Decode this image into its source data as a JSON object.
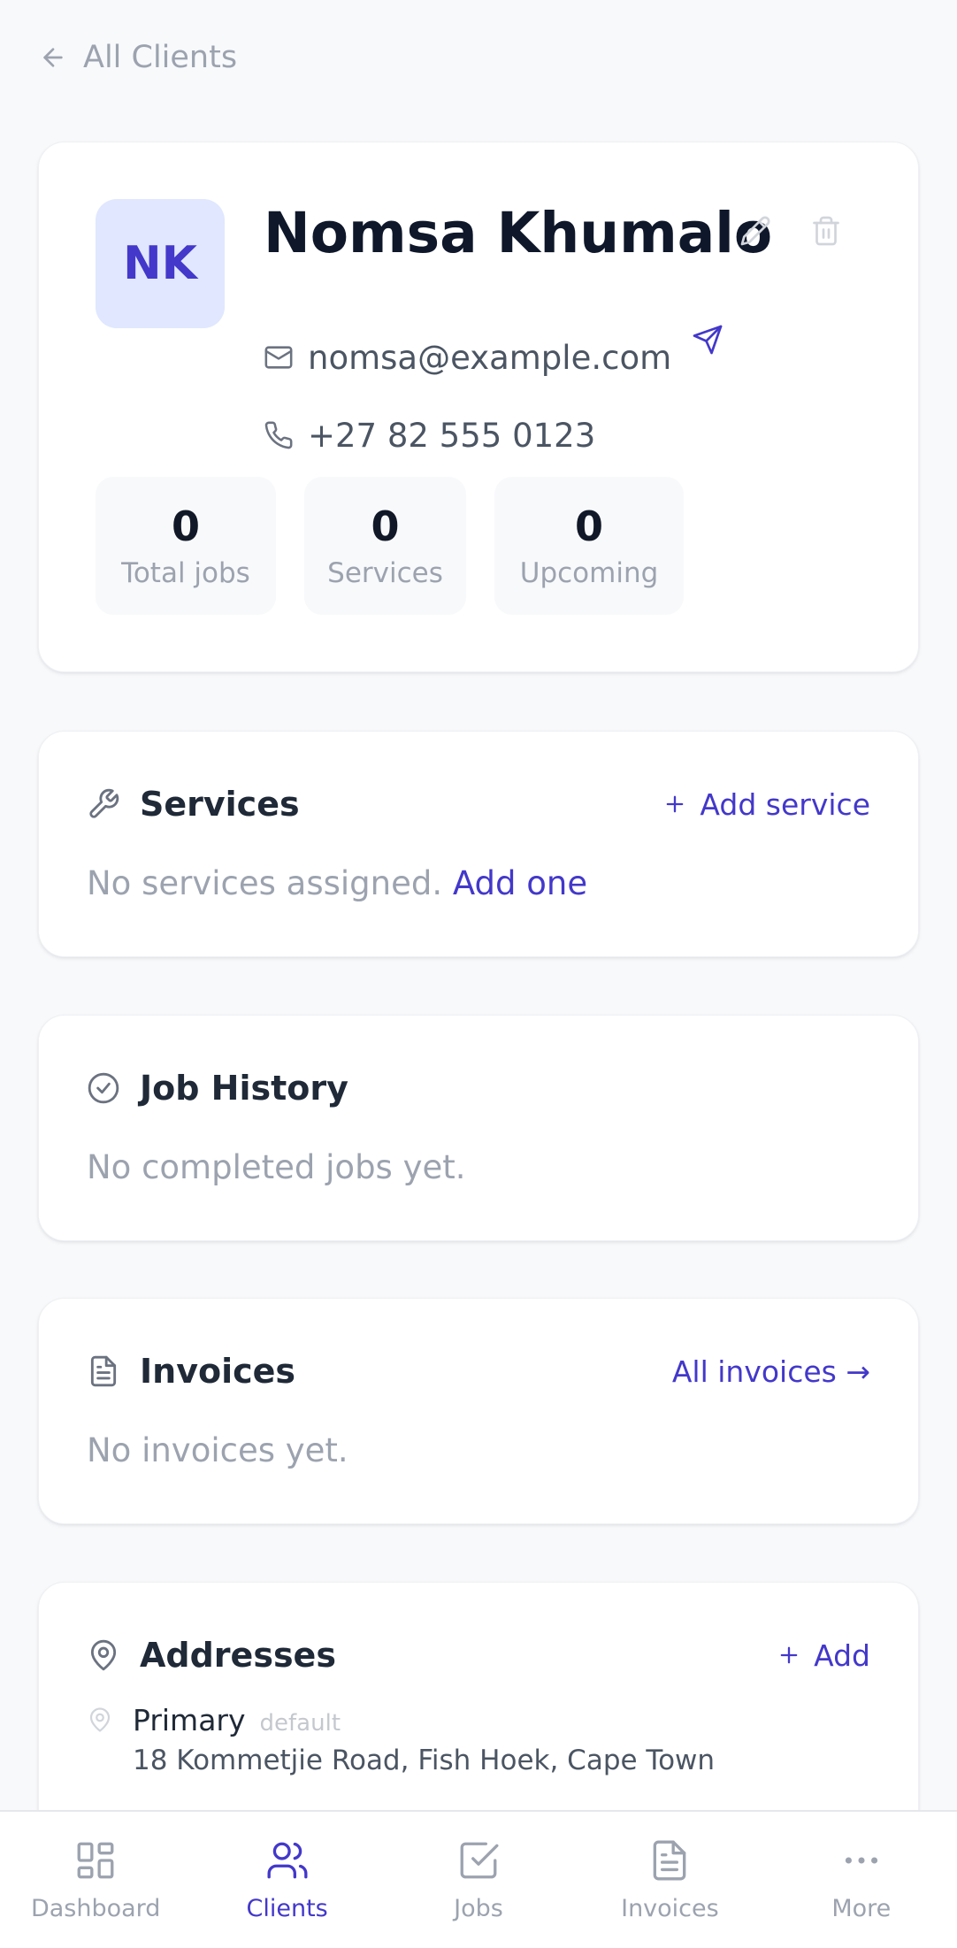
{
  "back_link": {
    "label": "All Clients",
    "icon": "arrow-left-icon"
  },
  "client": {
    "initials": "NK",
    "name": "Nomsa Khumalo",
    "email": "nomsa@example.com",
    "phone": "+27 82 555 0123",
    "actions": {
      "edit": "pencil-icon",
      "delete": "trash-icon",
      "send_email": "send-icon"
    }
  },
  "stats": [
    {
      "value": "0",
      "label": "Total jobs"
    },
    {
      "value": "0",
      "label": "Services"
    },
    {
      "value": "0",
      "label": "Upcoming"
    }
  ],
  "services": {
    "title": "Services",
    "action": "Add service",
    "empty_text": "No services assigned.",
    "empty_link": "Add one"
  },
  "job_history": {
    "title": "Job History",
    "empty_text": "No completed jobs yet."
  },
  "invoices": {
    "title": "Invoices",
    "action": "All invoices →",
    "empty_text": "No invoices yet."
  },
  "addresses": {
    "title": "Addresses",
    "action": "Add",
    "items": [
      {
        "name": "Primary",
        "badge": "default",
        "line": "18 Kommetjie Road, Fish Hoek, Cape Town"
      }
    ]
  },
  "nav": [
    {
      "label": "Dashboard",
      "icon": "grid-icon",
      "active": false
    },
    {
      "label": "Clients",
      "icon": "users-icon",
      "active": true
    },
    {
      "label": "Jobs",
      "icon": "check-square-icon",
      "active": false
    },
    {
      "label": "Invoices",
      "icon": "file-text-icon",
      "active": false
    },
    {
      "label": "More",
      "icon": "more-horizontal-icon",
      "active": false
    }
  ],
  "colors": {
    "accent": "#4338ca",
    "avatar_bg": "#e0e7ff",
    "background": "#f8f9fb",
    "muted_text": "#9ca3af"
  }
}
